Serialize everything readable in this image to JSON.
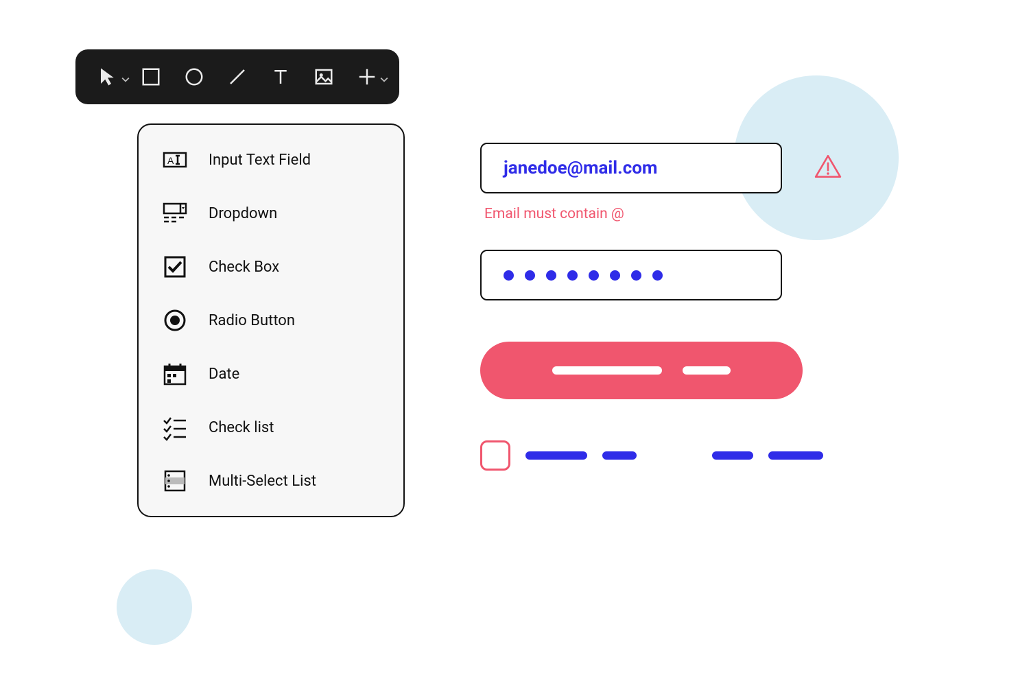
{
  "toolbar": {
    "tools": [
      {
        "id": "pointer",
        "hasDropdown": true
      },
      {
        "id": "square",
        "hasDropdown": false
      },
      {
        "id": "circle",
        "hasDropdown": false
      },
      {
        "id": "line",
        "hasDropdown": false
      },
      {
        "id": "text",
        "hasDropdown": false
      },
      {
        "id": "image",
        "hasDropdown": false
      },
      {
        "id": "plus",
        "hasDropdown": true
      }
    ]
  },
  "panel": {
    "items": [
      {
        "icon": "input-text-icon",
        "label": "Input Text Field"
      },
      {
        "icon": "dropdown-icon",
        "label": "Dropdown"
      },
      {
        "icon": "checkbox-icon",
        "label": "Check Box"
      },
      {
        "icon": "radio-icon",
        "label": "Radio Button"
      },
      {
        "icon": "date-icon",
        "label": "Date"
      },
      {
        "icon": "checklist-icon",
        "label": "Check list"
      },
      {
        "icon": "multiselect-icon",
        "label": "Multi-Select List"
      }
    ]
  },
  "form": {
    "email_value": "janedoe@mail.com",
    "email_error": "Email must contain @",
    "password_length": 8
  },
  "colors": {
    "accent_blue": "#2f2ce8",
    "accent_red": "#f0566e",
    "decor_blue": "#d9edf5",
    "panel_bg": "#f7f7f7",
    "toolbar_bg": "#1b1b1b"
  }
}
